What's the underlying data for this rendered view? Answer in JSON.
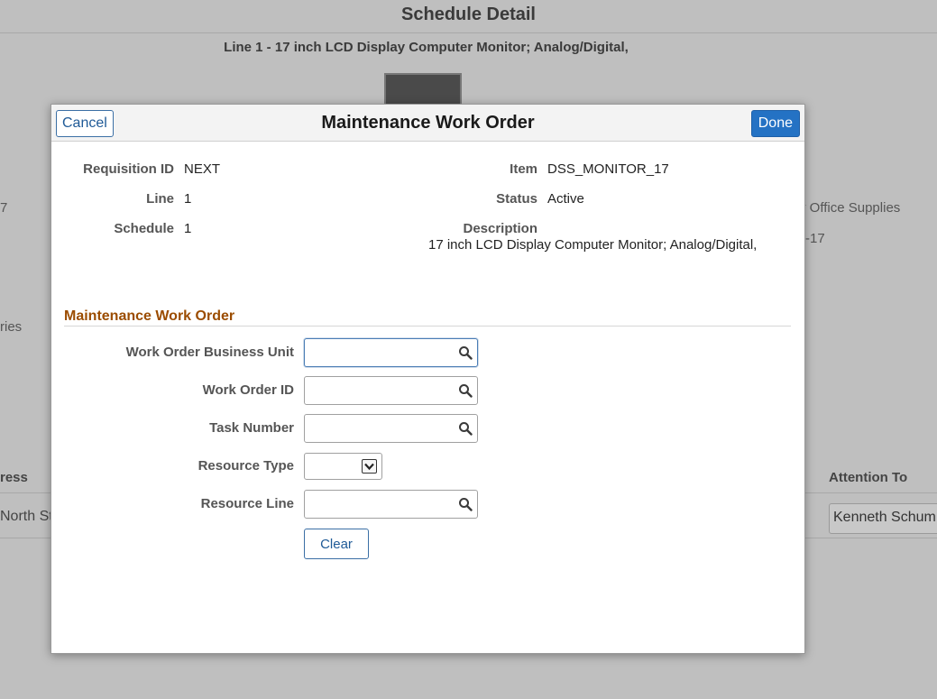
{
  "background": {
    "page_title": "Schedule Detail",
    "line_title": "Line 1 - 17 inch LCD Display Computer Monitor; Analog/Digital,",
    "left_fragment_1": "7",
    "left_fragment_2": "ries",
    "right_fragment_1": "y Office Supplies",
    "right_fragment_2": "-17",
    "table_header_left": "ress",
    "table_header_right": "Attention To",
    "table_cell_left": "North St",
    "attention_to_value": "Kenneth Schum"
  },
  "modal": {
    "title": "Maintenance Work Order",
    "cancel_label": "Cancel",
    "done_label": "Done",
    "summary": {
      "requisition_id_label": "Requisition ID",
      "requisition_id_value": "NEXT",
      "line_label": "Line",
      "line_value": "1",
      "schedule_label": "Schedule",
      "schedule_value": "1",
      "item_label": "Item",
      "item_value": "DSS_MONITOR_17",
      "status_label": "Status",
      "status_value": "Active",
      "description_label": "Description",
      "description_value": "17 inch LCD Display Computer Monitor; Analog/Digital,"
    },
    "section_title": "Maintenance Work Order",
    "fields": {
      "work_order_bu_label": "Work Order Business Unit",
      "work_order_bu_value": "",
      "work_order_id_label": "Work Order ID",
      "work_order_id_value": "",
      "task_number_label": "Task Number",
      "task_number_value": "",
      "resource_type_label": "Resource Type",
      "resource_type_value": "",
      "resource_line_label": "Resource Line",
      "resource_line_value": ""
    },
    "clear_label": "Clear"
  },
  "colors": {
    "accent_blue": "#2472c4",
    "section_orange": "#9b4c00",
    "overlay_gray": "#bfbfbf"
  },
  "icons": {
    "lookup": "search-icon",
    "dropdown": "chevron-down-icon"
  }
}
